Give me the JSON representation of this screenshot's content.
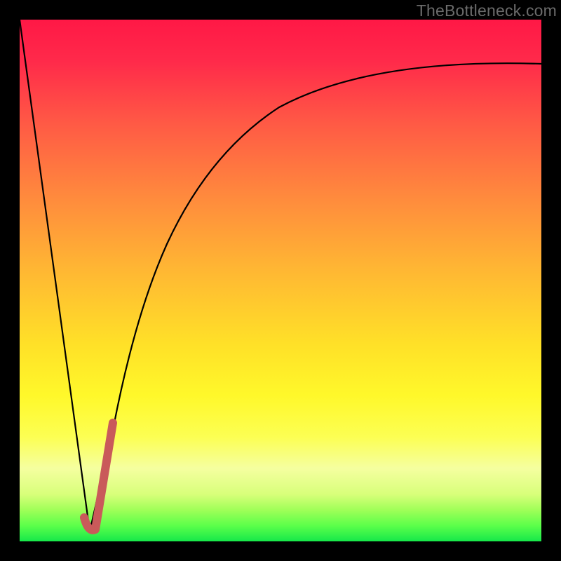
{
  "watermark": "TheBottleneck.com",
  "colors": {
    "curve": "#000000",
    "marker": "#c95a5a",
    "frame": "#000000"
  },
  "chart_data": {
    "type": "line",
    "title": "",
    "xlabel": "",
    "ylabel": "",
    "xlim": [
      0,
      100
    ],
    "ylim": [
      0,
      100
    ],
    "grid": false,
    "legend": false,
    "series": [
      {
        "name": "left-falling-line",
        "x": [
          0,
          13.5
        ],
        "y": [
          100,
          2
        ]
      },
      {
        "name": "right-rising-curve",
        "x": [
          13.5,
          18,
          22,
          26,
          30,
          35,
          40,
          46,
          53,
          61,
          70,
          80,
          90,
          100
        ],
        "y": [
          2,
          22,
          38,
          50,
          58,
          66,
          72,
          77,
          81,
          84.5,
          87,
          89,
          90.5,
          91.5
        ]
      },
      {
        "name": "marker-tick",
        "x": [
          12.5,
          13.5,
          17.5
        ],
        "y": [
          3.5,
          2,
          23
        ]
      }
    ],
    "annotations": []
  }
}
